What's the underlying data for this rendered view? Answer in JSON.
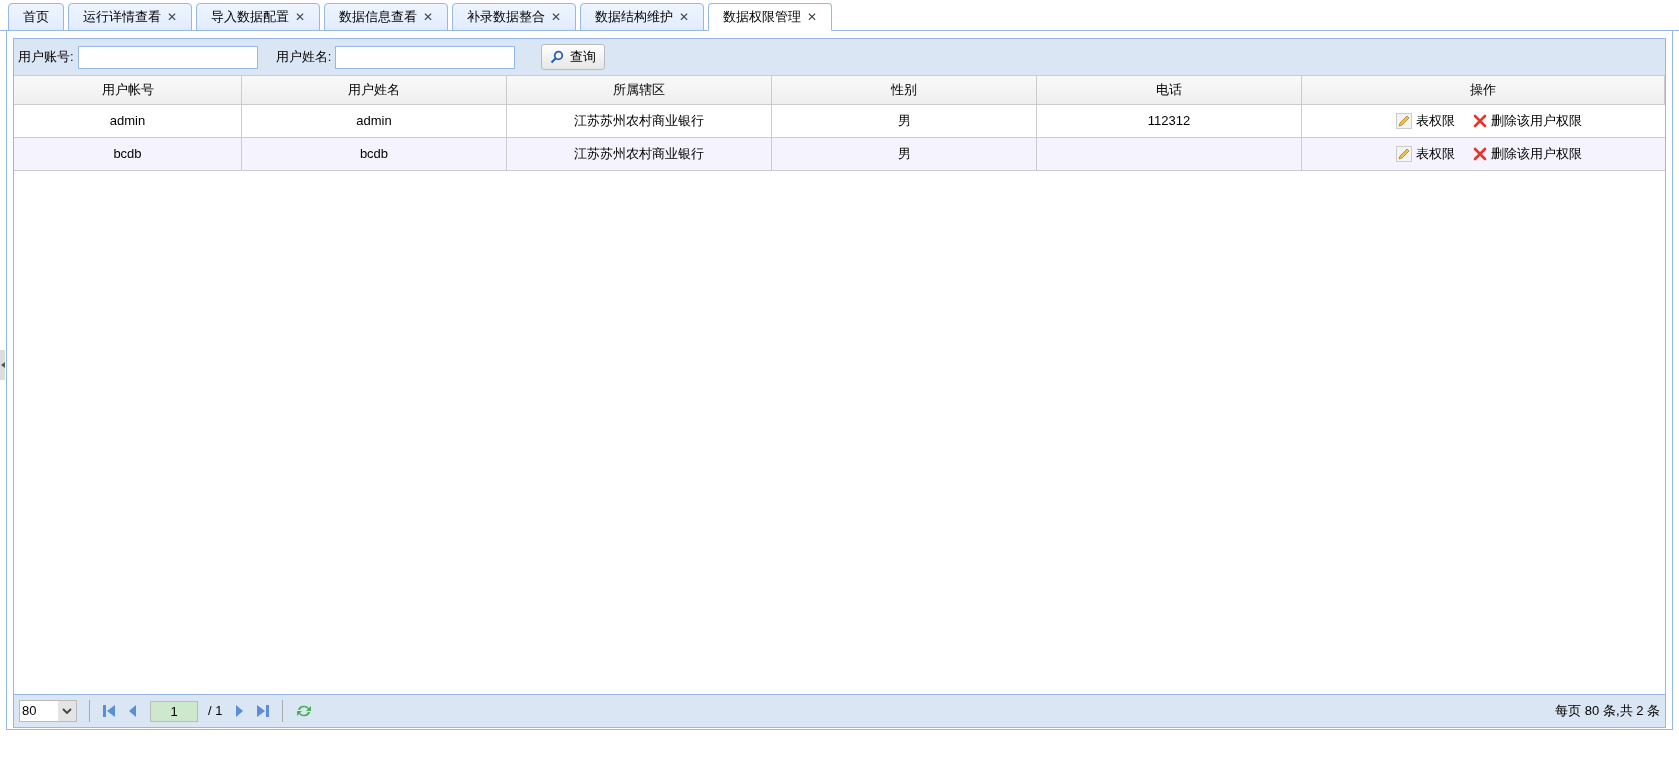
{
  "tabs": [
    {
      "label": "首页",
      "closable": false,
      "selected": false
    },
    {
      "label": "运行详情查看",
      "closable": true,
      "selected": false
    },
    {
      "label": "导入数据配置",
      "closable": true,
      "selected": false
    },
    {
      "label": "数据信息查看",
      "closable": true,
      "selected": false
    },
    {
      "label": "补录数据整合",
      "closable": true,
      "selected": false
    },
    {
      "label": "数据结构维护",
      "closable": true,
      "selected": false
    },
    {
      "label": "数据权限管理",
      "closable": true,
      "selected": true
    }
  ],
  "close_glyph": "✕",
  "search": {
    "fields": [
      {
        "label": "用户账号:"
      },
      {
        "label": "用户姓名:"
      }
    ],
    "button": "查询"
  },
  "table": {
    "columns": [
      "用户帐号",
      "用户姓名",
      "所属辖区",
      "性别",
      "电话",
      "操作"
    ],
    "rows": [
      {
        "cells": [
          "admin",
          "admin",
          "江苏苏州农村商业银行",
          "男",
          "112312"
        ],
        "highlighted": false,
        "actions": [
          {
            "kind": "edit",
            "label": "表权限"
          },
          {
            "kind": "delete",
            "label": "删除该用户权限"
          }
        ]
      },
      {
        "cells": [
          "bcdb",
          "bcdb",
          "江苏苏州农村商业银行",
          "男",
          ""
        ],
        "highlighted": true,
        "actions": [
          {
            "kind": "edit",
            "label": "表权限"
          },
          {
            "kind": "delete",
            "label": "删除该用户权限"
          }
        ]
      }
    ]
  },
  "pager": {
    "page_size": "80",
    "page": "1",
    "of": "/ 1",
    "summary": "每页 80 条,共 2 条"
  }
}
